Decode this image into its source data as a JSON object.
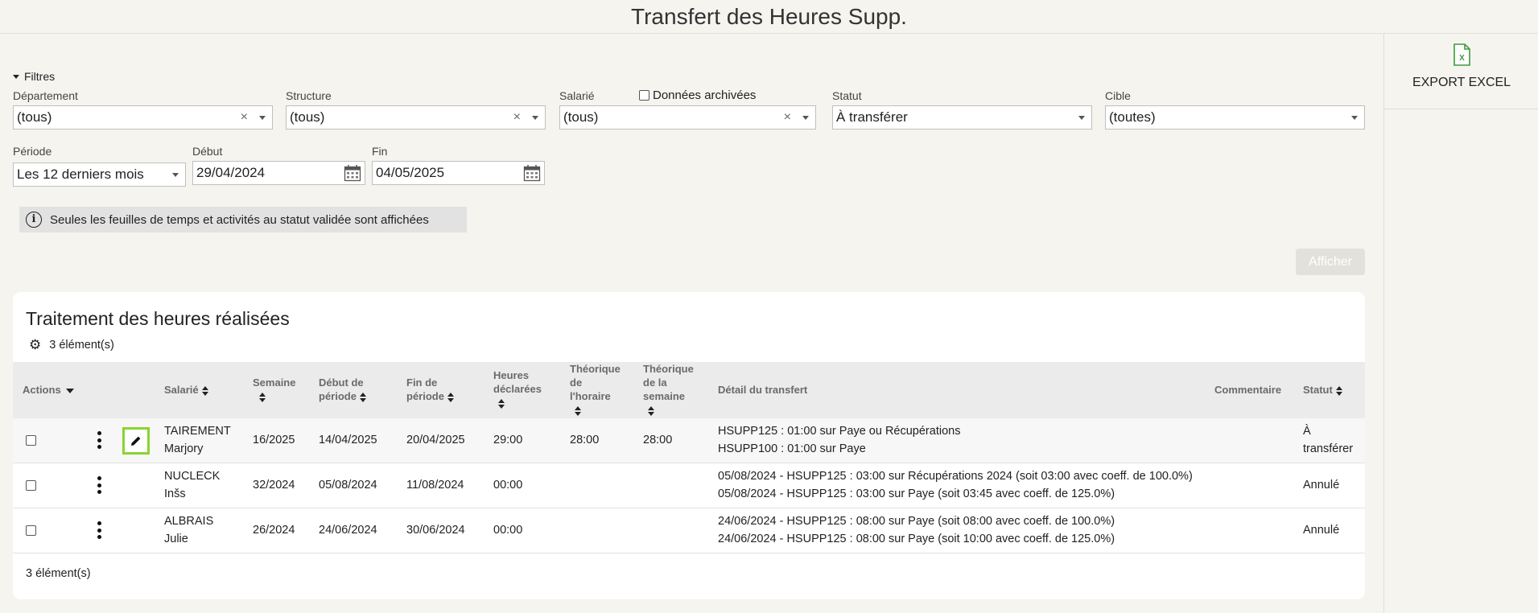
{
  "page": {
    "title": "Transfert des Heures Supp."
  },
  "export": {
    "label": "EXPORT EXCEL",
    "icon": "excel-icon"
  },
  "filters": {
    "toggle_label": "Filtres",
    "departement": {
      "label": "Département",
      "value": "(tous)"
    },
    "structure": {
      "label": "Structure",
      "value": "(tous)"
    },
    "salarie": {
      "label": "Salarié",
      "value": "(tous)"
    },
    "archived_label": "Données archivées",
    "statut": {
      "label": "Statut",
      "value": "À transférer"
    },
    "cible": {
      "label": "Cible",
      "value": "(toutes)"
    },
    "periode": {
      "label": "Période",
      "value": "Les 12 derniers mois"
    },
    "debut": {
      "label": "Début",
      "value": "29/04/2024"
    },
    "fin": {
      "label": "Fin",
      "value": "04/05/2025"
    }
  },
  "info": {
    "message": "Seules les feuilles de temps et activités au statut validée sont affichées"
  },
  "afficher_label": "Afficher",
  "table": {
    "title": "Traitement des heures réalisées",
    "count_label": "3 élément(s)",
    "headers": {
      "actions": "Actions",
      "salarie": "Salarié",
      "semaine": "Semaine",
      "debut_l1": "Début de",
      "debut_l2": "période",
      "fin_l1": "Fin de",
      "fin_l2": "période",
      "heures_l1": "Heures",
      "heures_l2": "déclarées",
      "th_horaire_l1": "Théorique",
      "th_horaire_l2": "de",
      "th_horaire_l3": "l'horaire",
      "th_semaine_l1": "Théorique",
      "th_semaine_l2": "de la",
      "th_semaine_l3": "semaine",
      "detail": "Détail du transfert",
      "commentaire": "Commentaire",
      "statut": "Statut"
    },
    "rows": [
      {
        "nom": "TAIREMENT",
        "prenom": "Marjory",
        "semaine": "16/2025",
        "debut": "14/04/2025",
        "fin": "20/04/2025",
        "heures": "29:00",
        "th_horaire": "28:00",
        "th_semaine": "28:00",
        "detail1": "HSUPP125 : 01:00 sur Paye ou Récupérations",
        "detail2": "HSUPP100 : 01:00 sur Paye",
        "commentaire": "",
        "statut1": "À",
        "statut2": "transférer"
      },
      {
        "nom": "NUCLECK",
        "prenom": "Inšs",
        "semaine": "32/2024",
        "debut": "05/08/2024",
        "fin": "11/08/2024",
        "heures": "00:00",
        "th_horaire": "",
        "th_semaine": "",
        "detail1": "05/08/2024 - HSUPP125 : 03:00 sur Récupérations 2024 (soit 03:00 avec coeff. de 100.0%)",
        "detail2": "05/08/2024 - HSUPP125 : 03:00 sur Paye (soit 03:45 avec coeff. de 125.0%)",
        "commentaire": "",
        "statut": "Annulé"
      },
      {
        "nom": "ALBRAIS",
        "prenom": "Julie",
        "semaine": "26/2024",
        "debut": "24/06/2024",
        "fin": "30/06/2024",
        "heures": "00:00",
        "th_horaire": "",
        "th_semaine": "",
        "detail1": "24/06/2024 - HSUPP125 : 08:00 sur Paye (soit 08:00 avec coeff. de 100.0%)",
        "detail2": "24/06/2024 - HSUPP125 : 08:00 sur Paye (soit 10:00 avec coeff. de 125.0%)",
        "commentaire": "",
        "statut": "Annulé"
      }
    ],
    "footer_count": "3 élément(s)"
  }
}
